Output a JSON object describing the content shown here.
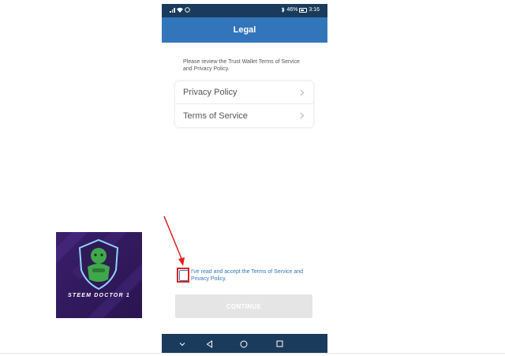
{
  "status_bar": {
    "battery": "46%",
    "time": "3:16"
  },
  "header": {
    "title": "Legal"
  },
  "intro_text": "Please review the Trust Wallet Terms of Service and Privacy Policy.",
  "legal_links": [
    {
      "label": "Privacy Policy",
      "icon": "chevron-right-icon"
    },
    {
      "label": "Terms of Service",
      "icon": "chevron-right-icon"
    }
  ],
  "accept": {
    "checked": false,
    "text": "I've read and accept the Terms of Service and Privacy Policy."
  },
  "continue_button": {
    "label": "CONTINUE",
    "enabled": false
  },
  "nav_bar": {
    "items": [
      "chevron-down-icon",
      "back-triangle-icon",
      "home-circle-icon",
      "recents-square-icon"
    ]
  },
  "overlay_logo": {
    "text": "STEEM DOCTOR 1"
  },
  "colors": {
    "app_bar": "#3375bb",
    "status_bar": "#1b3b5c",
    "nav_bar": "#1b3b5c",
    "link": "#3375bb",
    "button_disabled": "#e5e5e5",
    "annotation": "#e02020",
    "logo_bg": "#3a1f6b",
    "logo_accent": "#3fa84a"
  }
}
